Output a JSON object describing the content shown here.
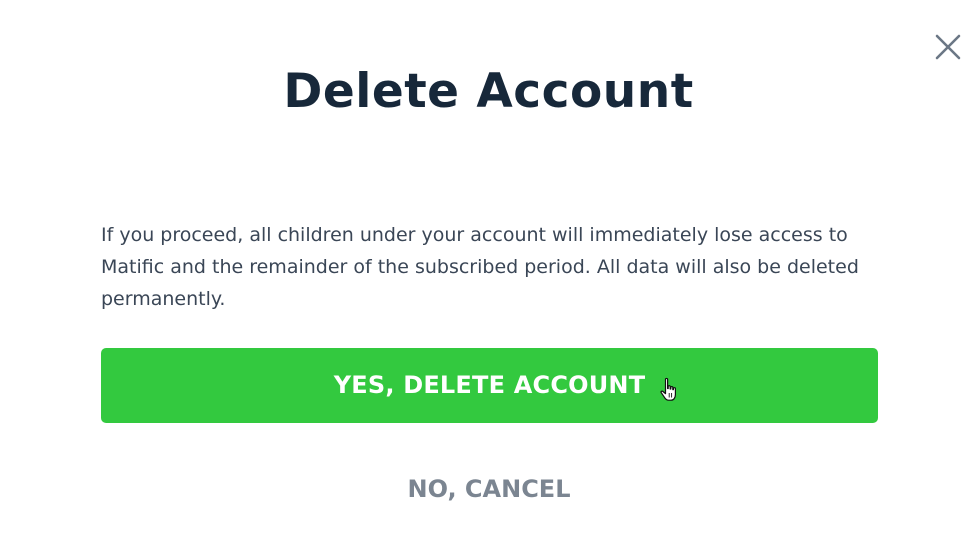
{
  "dialog": {
    "title": "Delete Account",
    "message": "If you proceed, all children under your account will immediately lose access to Matific and the remainder of the subscribed period. All data will also be deleted permanently.",
    "confirm_label": "YES, DELETE ACCOUNT",
    "cancel_label": "NO, CANCEL",
    "close_icon": "close-icon",
    "cursor_icon": "hand-pointer-icon"
  },
  "colors": {
    "title": "#17283a",
    "message": "#3a4656",
    "confirm_bg": "#33c93f",
    "confirm_text": "#ffffff",
    "cancel_text": "#7b8591",
    "close_icon": "#6b7785"
  }
}
